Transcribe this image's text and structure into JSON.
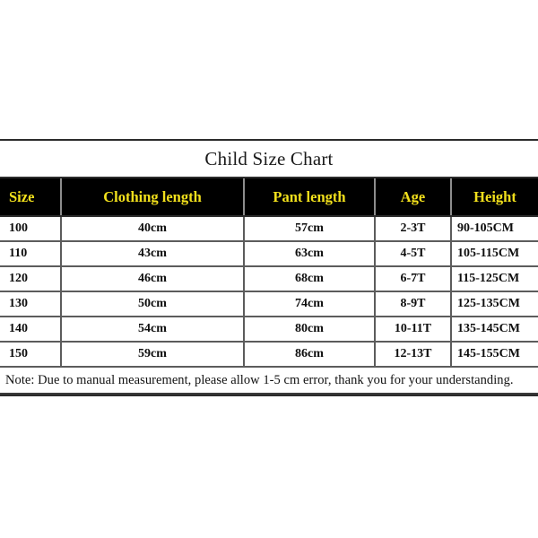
{
  "document": {
    "title": "Child Size Chart",
    "background_color": "#ffffff",
    "header_background": "#000000",
    "header_text_color": "#f2e01c",
    "body_text_color": "#0e0e0e"
  },
  "table": {
    "columns": [
      {
        "key": "size",
        "label": "Size"
      },
      {
        "key": "cloth",
        "label": "Clothing length"
      },
      {
        "key": "pant",
        "label": "Pant length"
      },
      {
        "key": "age",
        "label": "Age"
      },
      {
        "key": "height",
        "label": "Height"
      }
    ],
    "rows": [
      {
        "size": "100",
        "cloth": "40cm",
        "pant": "57cm",
        "age": "2-3T",
        "height": "90-105CM"
      },
      {
        "size": "110",
        "cloth": "43cm",
        "pant": "63cm",
        "age": "4-5T",
        "height": "105-115CM"
      },
      {
        "size": "120",
        "cloth": "46cm",
        "pant": "68cm",
        "age": "6-7T",
        "height": "115-125CM"
      },
      {
        "size": "130",
        "cloth": "50cm",
        "pant": "74cm",
        "age": "8-9T",
        "height": "125-135CM"
      },
      {
        "size": "140",
        "cloth": "54cm",
        "pant": "80cm",
        "age": "10-11T",
        "height": "135-145CM"
      },
      {
        "size": "150",
        "cloth": "59cm",
        "pant": "86cm",
        "age": "12-13T",
        "height": "145-155CM"
      }
    ],
    "note": "Note: Due to manual measurement, please allow 1-5 cm error, thank you for your understanding."
  }
}
